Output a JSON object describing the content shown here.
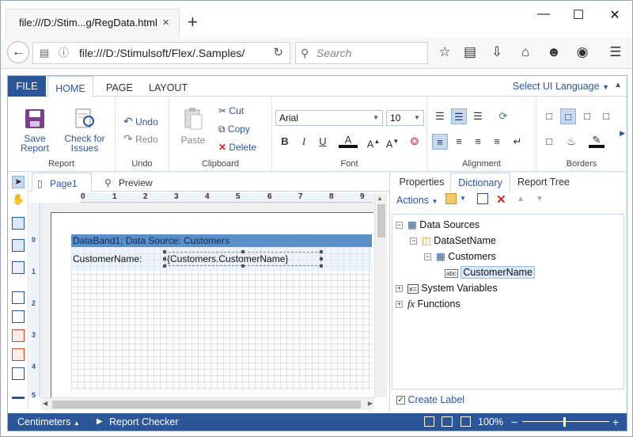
{
  "browser": {
    "tab_title": "file:///D:/Stim...g/RegData.html",
    "close_tab": "×",
    "new_tab": "+",
    "url": "file:///D:/Stimulsoft/Flex/.Samples/",
    "search_placeholder": "Search"
  },
  "ribbon_tabs": {
    "file": "FILE",
    "home": "HOME",
    "page": "PAGE",
    "layout": "LAYOUT",
    "language": "Select UI Language"
  },
  "report_group": {
    "save_report": "Save Report",
    "check_for_issues": "Check for Issues",
    "label": "Report"
  },
  "undo_group": {
    "undo": "Undo",
    "redo": "Redo",
    "label": "Undo"
  },
  "clipboard_group": {
    "paste": "Paste",
    "cut": "Cut",
    "copy": "Copy",
    "delete": "Delete",
    "label": "Clipboard"
  },
  "font_group": {
    "font_name": "Arial",
    "font_size": "10",
    "bold": "B",
    "italic": "I",
    "underline": "U",
    "color_letter": "A",
    "grow": "A",
    "shrink": "A",
    "label": "Font"
  },
  "alignment_group": {
    "label": "Alignment"
  },
  "borders_group": {
    "label": "Borders"
  },
  "doc_tabs": {
    "page1": "Page1",
    "preview": "Preview"
  },
  "ruler": {
    "h_ticks": [
      "0",
      "1",
      "2",
      "3",
      "4",
      "5",
      "6",
      "7",
      "8",
      "9"
    ],
    "v_ticks": [
      "0",
      "1",
      "2",
      "3",
      "4",
      "5"
    ]
  },
  "designer": {
    "band_header": "DataBand1; Data Source: Customers",
    "field_label": "CustomerName:",
    "field_expression": "{Customers.CustomerName}"
  },
  "panel_tabs": {
    "properties": "Properties",
    "dictionary": "Dictionary",
    "report_tree": "Report Tree"
  },
  "dictionary": {
    "actions": "Actions",
    "tree": {
      "data_sources": "Data Sources",
      "dataset": "DataSetName",
      "customers": "Customers",
      "customer_name": "CustomerName",
      "system_variables": "System Variables",
      "functions": "Functions"
    },
    "create_label": "Create Label"
  },
  "status_bar": {
    "units": "Centimeters",
    "report_checker": "Report Checker",
    "zoom": "100%"
  },
  "colors": {
    "accent": "#2b579a",
    "band": "#5b8fc9",
    "delete": "#d9251d"
  }
}
